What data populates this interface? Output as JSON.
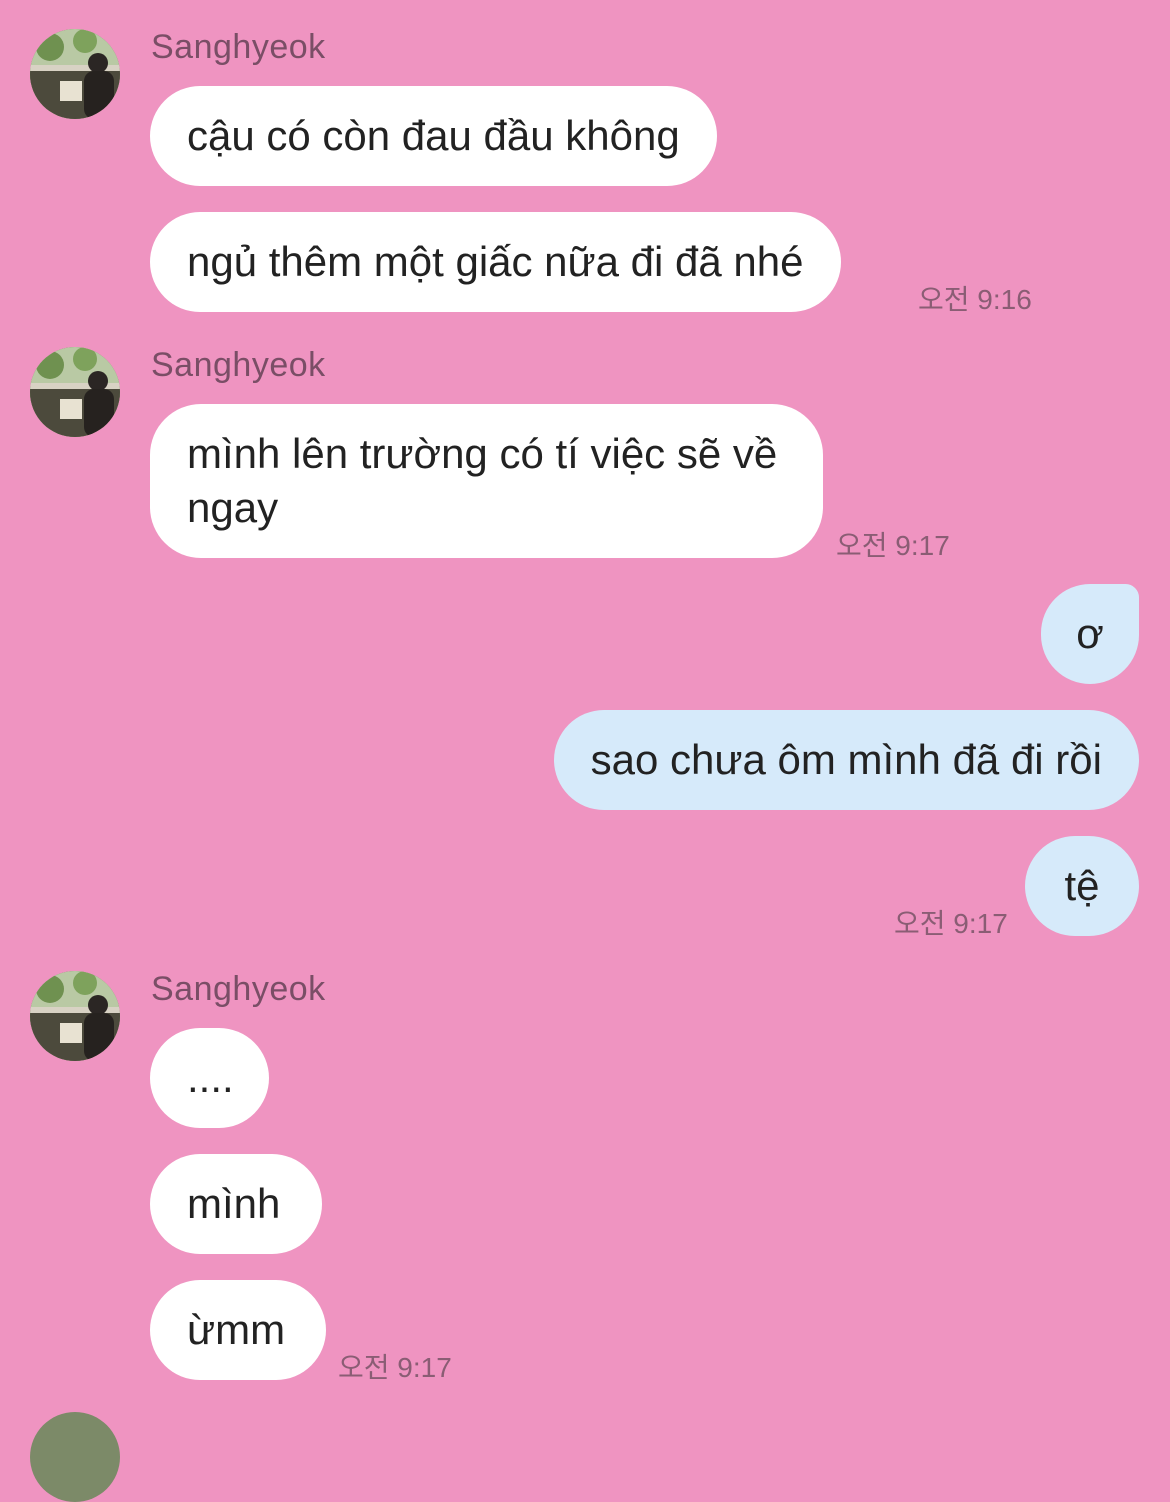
{
  "chat": {
    "groups": [
      {
        "sender": "Sanghyeok",
        "messages": [
          "cậu có còn đau đầu không",
          "ngủ thêm một giấc nữa đi đã nhé"
        ],
        "time": "오전 9:16"
      },
      {
        "sender": "Sanghyeok",
        "messages": [
          "mình lên trường có tí việc sẽ về ngay"
        ],
        "time": "오전 9:17"
      },
      {
        "sender": "me",
        "messages": [
          "ơ",
          "sao chưa ôm mình đã đi rồi",
          "tệ"
        ],
        "time": "오전 9:17"
      },
      {
        "sender": "Sanghyeok",
        "messages": [
          "....",
          "mình",
          "ừmm"
        ],
        "time": "오전 9:17"
      }
    ]
  },
  "theme": {
    "background": "#ef94c1",
    "incoming_bubble": "#ffffff",
    "outgoing_bubble": "#d6eafa"
  },
  "icons": {
    "avatar": "avatar-photo"
  }
}
